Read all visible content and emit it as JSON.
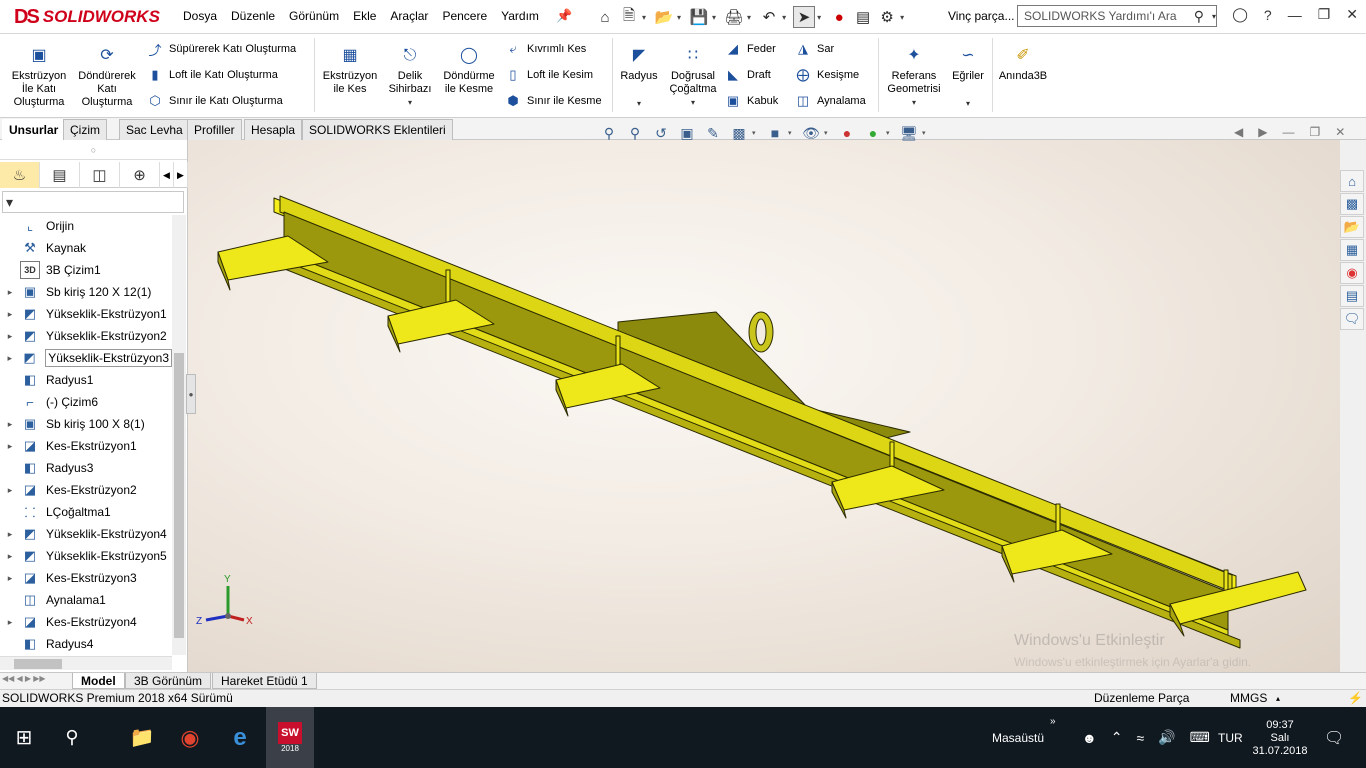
{
  "app": {
    "brand": "SOLIDWORKS",
    "brand_mark": "DS",
    "doc_name": "Vinç parça...",
    "search_placeholder": "SOLIDWORKS Yardımı'ı Ara"
  },
  "menu": [
    "Dosya",
    "Düzenle",
    "Görünüm",
    "Ekle",
    "Araçlar",
    "Pencere",
    "Yardım"
  ],
  "ribbon": {
    "extrude": "Ekstrüzyon İle Katı Oluşturma",
    "revolve": "Döndürerek Katı Oluşturma",
    "sweep": "Süpürerek Katı Oluşturma",
    "loft": "Loft ile Katı Oluşturma",
    "boundary": "Sınır ile Katı Oluşturma",
    "extrude_cut": "Ekstrüzyon ile Kes",
    "hole_wizard": "Delik Sihirbazı",
    "revolve_cut": "Döndürme ile Kesme",
    "swept_cut": "Kıvrımlı Kes",
    "loft_cut": "Loft ile Kesim",
    "boundary_cut": "Sınır ile Kesme",
    "fillet": "Radyus",
    "linear_pattern": "Doğrusal Çoğaltma",
    "rib": "Feder",
    "draft": "Draft",
    "shell": "Kabuk",
    "wrap": "Sar",
    "intersect": "Kesişme",
    "mirror": "Aynalama",
    "ref_geom": "Referans Geometrisi",
    "curves": "Eğriler",
    "instant3d": "Anında3B"
  },
  "tabs": [
    "Unsurlar",
    "Çizim",
    "Sac Levha",
    "Profiller",
    "Hesapla",
    "SOLIDWORKS Eklentileri"
  ],
  "tree": [
    {
      "label": "Orijin",
      "icon": "origin-icon",
      "expand": ""
    },
    {
      "label": "Kaynak",
      "icon": "weld-icon",
      "expand": ""
    },
    {
      "label": "3B Çizim1",
      "icon": "sketch3d-icon",
      "expand": ""
    },
    {
      "label": "Sb kiriş 120 X 12(1)",
      "icon": "structural-member-icon",
      "expand": "▸"
    },
    {
      "label": "Yükseklik-Ekstrüzyon1",
      "icon": "boss-extrude-icon",
      "expand": "▸"
    },
    {
      "label": "Yükseklik-Ekstrüzyon2",
      "icon": "boss-extrude-icon",
      "expand": "▸"
    },
    {
      "label": "Yükseklik-Ekstrüzyon3",
      "icon": "boss-extrude-icon",
      "expand": "▸"
    },
    {
      "label": "Radyus1",
      "icon": "fillet-icon",
      "expand": ""
    },
    {
      "label": "(-) Çizim6",
      "icon": "sketch-icon",
      "expand": ""
    },
    {
      "label": "Sb kiriş 100 X 8(1)",
      "icon": "structural-member-icon",
      "expand": "▸"
    },
    {
      "label": "Kes-Ekstrüzyon1",
      "icon": "cut-extrude-icon",
      "expand": "▸"
    },
    {
      "label": "Radyus3",
      "icon": "fillet-icon",
      "expand": ""
    },
    {
      "label": "Kes-Ekstrüzyon2",
      "icon": "cut-extrude-icon",
      "expand": "▸"
    },
    {
      "label": "LÇoğaltma1",
      "icon": "linear-pattern-icon",
      "expand": ""
    },
    {
      "label": "Yükseklik-Ekstrüzyon4",
      "icon": "boss-extrude-icon",
      "expand": "▸"
    },
    {
      "label": "Yükseklik-Ekstrüzyon5",
      "icon": "boss-extrude-icon",
      "expand": "▸"
    },
    {
      "label": "Kes-Ekstrüzyon3",
      "icon": "cut-extrude-icon",
      "expand": "▸"
    },
    {
      "label": "Aynalama1",
      "icon": "mirror-icon",
      "expand": ""
    },
    {
      "label": "Kes-Ekstrüzyon4",
      "icon": "cut-extrude-icon",
      "expand": "▸"
    },
    {
      "label": "Radyus4",
      "icon": "fillet-icon",
      "expand": ""
    }
  ],
  "triad": {
    "x": "X",
    "y": "Y",
    "z": "Z"
  },
  "bottom_tabs": [
    "Model",
    "3B Görünüm",
    "Hareket Etüdü 1"
  ],
  "status": {
    "left": "SOLIDWORKS Premium 2018 x64 Sürümü",
    "mode": "Düzenleme Parça",
    "units": "MMGS"
  },
  "watermark": {
    "line1": "Windows'u Etkinleştir",
    "line2": "Windows'u etkinleştirmek için Ayarlar'a gidin."
  },
  "taskbar": {
    "desktop": "Masaüstü",
    "lang": "TUR",
    "time": "09:37",
    "day": "Salı",
    "date": "31.07.2018",
    "sw_badge": "2018"
  }
}
